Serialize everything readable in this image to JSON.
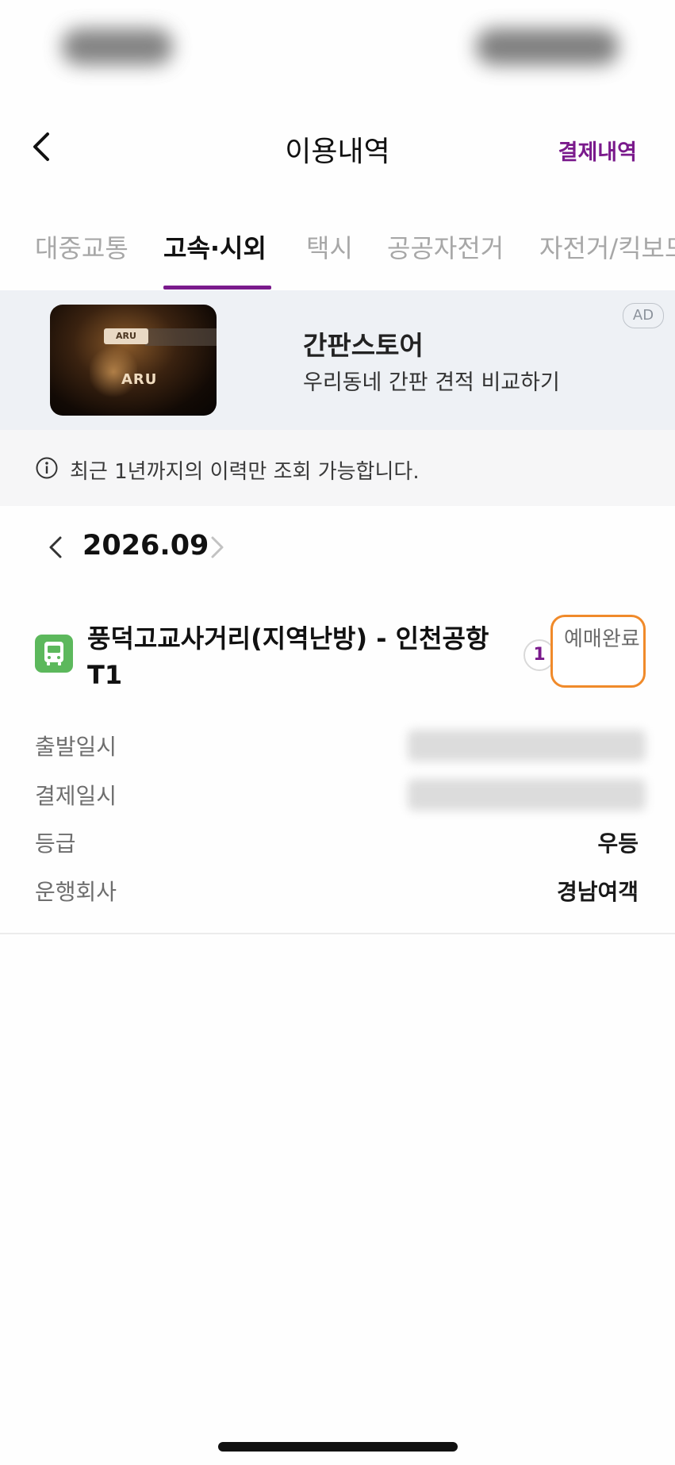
{
  "header": {
    "title": "이용내역",
    "payment_link": "결제내역"
  },
  "tabs": [
    {
      "label": "대중교통",
      "active": false
    },
    {
      "label": "고속·시외",
      "active": true
    },
    {
      "label": "택시",
      "active": false
    },
    {
      "label": "공공자전거",
      "active": false
    },
    {
      "label": "자전거/킥보드",
      "active": false
    }
  ],
  "ad": {
    "title": "간판스토어",
    "subtitle": "우리동네 간판 견적 비교하기",
    "badge": "AD",
    "image_sign_small": "ARU",
    "image_sign_large": "ARU"
  },
  "notice": {
    "text": "최근 1년까지의 이력만 조회 가능합니다."
  },
  "month_nav": {
    "label": "2026.09"
  },
  "trip": {
    "route": "풍덕고교사거리(지역난방) - 인천공항 T1",
    "count": "1",
    "status": "예매완료",
    "details": [
      {
        "label": "출발일시",
        "value": ""
      },
      {
        "label": "결제일시",
        "value": ""
      },
      {
        "label": "등급",
        "value": "우등"
      },
      {
        "label": "운행회사",
        "value": "경남여객"
      }
    ]
  },
  "colors": {
    "accent": "#7a1a8c",
    "bus_icon": "#5cb85c",
    "status_highlight": "#f08a2a"
  }
}
